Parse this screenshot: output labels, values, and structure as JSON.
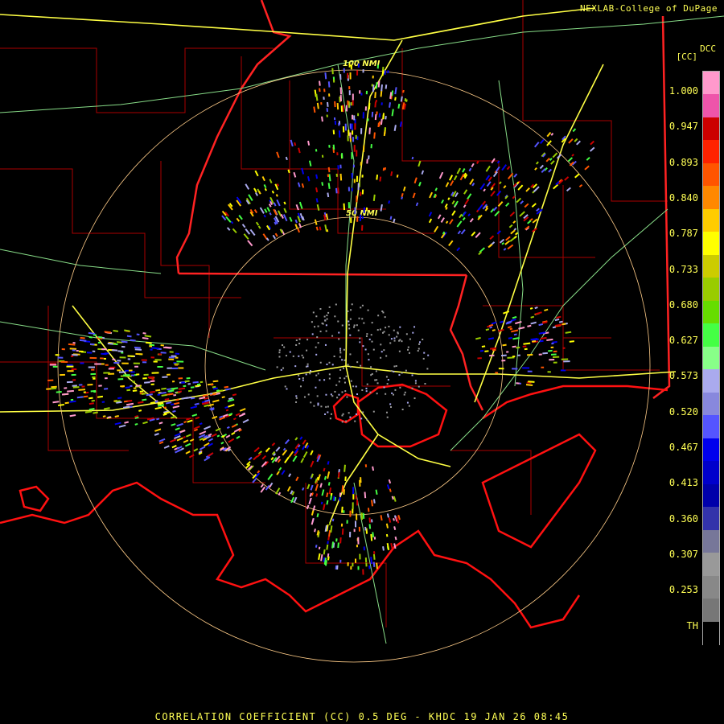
{
  "header": {
    "credit": "NEXLAB-College of DuPage"
  },
  "footer": {
    "title": "CORRELATION COEFFICIENT (CC) 0.5 DEG - KHDC 19 JAN 26 08:45"
  },
  "legend": {
    "product": "DCC",
    "unit": "[CC]",
    "labels": [
      "1.000",
      "0.947",
      "0.893",
      "0.840",
      "0.787",
      "0.733",
      "0.680",
      "0.627",
      "0.573",
      "0.520",
      "0.467",
      "0.413",
      "0.360",
      "0.307",
      "0.253",
      "TH"
    ],
    "colors": [
      "#ff99cc",
      "#ee55aa",
      "#cc0000",
      "#ff2200",
      "#ff5500",
      "#ff8800",
      "#ffcc00",
      "#ffff00",
      "#cccc00",
      "#99cc00",
      "#66dd00",
      "#44ff44",
      "#88ff88",
      "#aaaaee",
      "#8888dd",
      "#5555ff",
      "#0000ee",
      "#0000cc",
      "#0000aa",
      "#3333aa",
      "#777799",
      "#999999",
      "#888888",
      "#777777",
      "#000000"
    ]
  },
  "rings": [
    {
      "label": "50 NMI"
    },
    {
      "label": "100 NMI"
    }
  ],
  "map_colors": {
    "background": "#000000",
    "borders": "#aa0000",
    "state_lines": "#ff2222",
    "coast": "#ff1111",
    "roads": "#88dd88",
    "interstates": "#ffff44",
    "rings": "#ffcc88"
  }
}
